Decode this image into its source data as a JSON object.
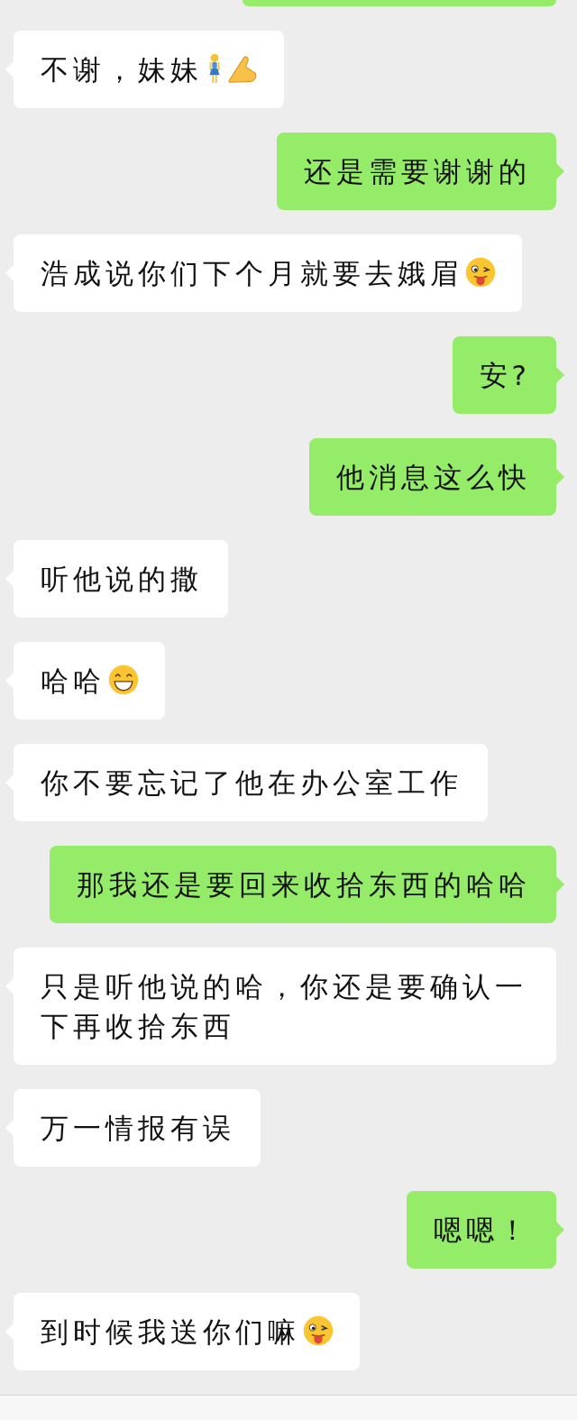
{
  "chat": {
    "top_cut": {
      "kind": "outgoing"
    },
    "messages": [
      {
        "kind": "incoming",
        "text": "不谢，妹妹",
        "emojis": [
          {
            "kind": "woman"
          },
          {
            "kind": "hands"
          }
        ]
      },
      {
        "kind": "outgoing",
        "text": "还是需要谢谢的"
      },
      {
        "kind": "incoming",
        "text": "浩成说你们下个月就要去娥眉",
        "emojis": [
          {
            "kind": "wink_tongue"
          }
        ]
      },
      {
        "kind": "outgoing",
        "text": "安?"
      },
      {
        "kind": "outgoing",
        "text": "他消息这么快"
      },
      {
        "kind": "incoming",
        "text": "听他说的撒"
      },
      {
        "kind": "incoming",
        "text": "哈哈",
        "emojis": [
          {
            "kind": "grin"
          }
        ]
      },
      {
        "kind": "incoming",
        "text": "你不要忘记了他在办公室工作"
      },
      {
        "kind": "outgoing",
        "text": "那我还是要回来收拾东西的哈哈"
      },
      {
        "kind": "incoming",
        "text": "只是听他说的哈，你还是要确认一下再收拾东西"
      },
      {
        "kind": "incoming",
        "text": "万一情报有误"
      },
      {
        "kind": "outgoing",
        "text": "嗯嗯！"
      },
      {
        "kind": "incoming",
        "text": "到时候我送你们嘛",
        "emojis": [
          {
            "kind": "wink_tongue"
          }
        ]
      }
    ]
  }
}
